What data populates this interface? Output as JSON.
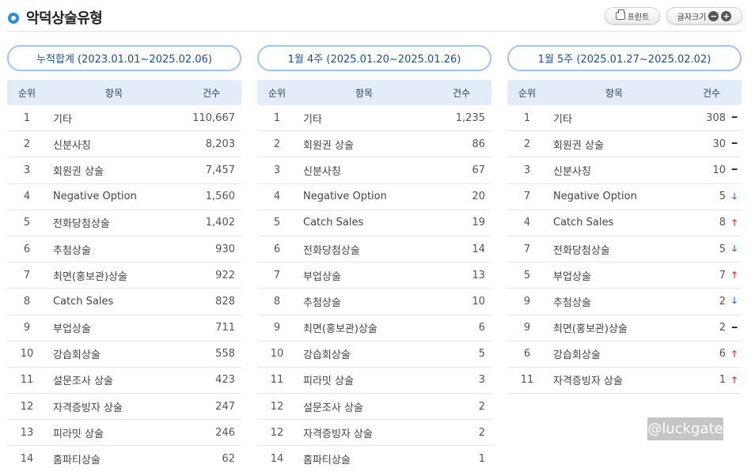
{
  "header": {
    "title": "악덕상술유형",
    "print_label": "프린트",
    "font_size_label": "글자크기",
    "minus": "−",
    "plus": "+"
  },
  "columns": {
    "rank": "순위",
    "item": "항목",
    "count": "건수"
  },
  "panels": [
    {
      "period": "누적합계 (2023.01.01~2025.02.06)",
      "rows": [
        {
          "rank": "1",
          "item": "기타",
          "count": "110,667"
        },
        {
          "rank": "2",
          "item": "신분사칭",
          "count": "8,203"
        },
        {
          "rank": "3",
          "item": "회원권 상술",
          "count": "7,457"
        },
        {
          "rank": "4",
          "item": "Negative Option",
          "count": "1,560"
        },
        {
          "rank": "5",
          "item": "전화당첨상술",
          "count": "1,402"
        },
        {
          "rank": "6",
          "item": "추첨상술",
          "count": "930"
        },
        {
          "rank": "7",
          "item": "최면(홍보관)상술",
          "count": "922"
        },
        {
          "rank": "8",
          "item": "Catch Sales",
          "count": "828"
        },
        {
          "rank": "9",
          "item": "부업상술",
          "count": "711"
        },
        {
          "rank": "10",
          "item": "강습회상술",
          "count": "558"
        },
        {
          "rank": "11",
          "item": "설문조사 상술",
          "count": "423"
        },
        {
          "rank": "12",
          "item": "자격증빙자 상술",
          "count": "247"
        },
        {
          "rank": "13",
          "item": "피라밋 상술",
          "count": "246"
        },
        {
          "rank": "14",
          "item": "홈파티상술",
          "count": "62"
        }
      ]
    },
    {
      "period": "1월 4주 (2025.01.20~2025.01.26)",
      "rows": [
        {
          "rank": "1",
          "item": "기타",
          "count": "1,235"
        },
        {
          "rank": "2",
          "item": "회원권 상술",
          "count": "86"
        },
        {
          "rank": "3",
          "item": "신분사칭",
          "count": "67"
        },
        {
          "rank": "4",
          "item": "Negative Option",
          "count": "20"
        },
        {
          "rank": "5",
          "item": "Catch Sales",
          "count": "19"
        },
        {
          "rank": "6",
          "item": "전화당첨상술",
          "count": "14"
        },
        {
          "rank": "7",
          "item": "부업상술",
          "count": "13"
        },
        {
          "rank": "8",
          "item": "추첨상술",
          "count": "10"
        },
        {
          "rank": "9",
          "item": "최면(홍보관)상술",
          "count": "6"
        },
        {
          "rank": "10",
          "item": "강습회상술",
          "count": "5"
        },
        {
          "rank": "11",
          "item": "피라밋 상술",
          "count": "3"
        },
        {
          "rank": "12",
          "item": "설문조사 상술",
          "count": "2"
        },
        {
          "rank": "12",
          "item": "자격증빙자 상술",
          "count": "2"
        },
        {
          "rank": "14",
          "item": "홈파티상술",
          "count": "1"
        }
      ]
    },
    {
      "period": "1월 5주 (2025.01.27~2025.02.02)",
      "rows": [
        {
          "rank": "1",
          "item": "기타",
          "count": "308",
          "trend": "same"
        },
        {
          "rank": "2",
          "item": "회원권 상술",
          "count": "30",
          "trend": "same"
        },
        {
          "rank": "3",
          "item": "신분사칭",
          "count": "10",
          "trend": "same"
        },
        {
          "rank": "7",
          "item": "Negative Option",
          "count": "5",
          "trend": "down"
        },
        {
          "rank": "4",
          "item": "Catch Sales",
          "count": "8",
          "trend": "up"
        },
        {
          "rank": "7",
          "item": "전화당첨상술",
          "count": "5",
          "trend": "down"
        },
        {
          "rank": "5",
          "item": "부업상술",
          "count": "7",
          "trend": "up"
        },
        {
          "rank": "9",
          "item": "추첨상술",
          "count": "2",
          "trend": "down"
        },
        {
          "rank": "9",
          "item": "최면(홍보관)상술",
          "count": "2",
          "trend": "same"
        },
        {
          "rank": "6",
          "item": "강습회상술",
          "count": "6",
          "trend": "up"
        },
        {
          "rank": "11",
          "item": "자격증빙자 상술",
          "count": "1",
          "trend": "up"
        }
      ]
    }
  ],
  "trend_glyphs": {
    "same": "━",
    "up": "🡑",
    "down": "🡓"
  },
  "trend_colors": {
    "same": "#222222",
    "up": "#d62020",
    "down": "#2a63c8"
  },
  "watermark": "@luckgate"
}
